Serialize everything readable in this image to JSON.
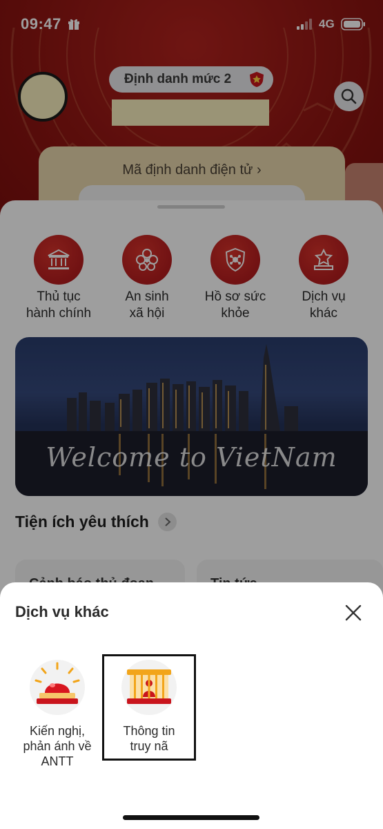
{
  "status_bar": {
    "time": "09:47",
    "network": "4G",
    "icons": [
      "gift-icon",
      "signal-icon",
      "battery-icon"
    ]
  },
  "header": {
    "level_badge": "Định danh mức 2",
    "id_card_title": "Mã định danh điện tử",
    "colors": {
      "header_red": "#8f1512",
      "card_beige": "#e9d7ad"
    }
  },
  "services": [
    {
      "label": "Thủ tục\nhành chính",
      "icon": "government-building-icon"
    },
    {
      "label": "An sinh\nxã hội",
      "icon": "social-welfare-icon"
    },
    {
      "label": "Hồ sơ sức\nkhỏe",
      "icon": "health-shield-icon"
    },
    {
      "label": "Dịch vụ\nkhác",
      "icon": "star-podium-icon"
    }
  ],
  "banner": {
    "text": "Welcome to VietNam"
  },
  "favorites": {
    "title": "Tiện ích yêu thích",
    "cards": [
      "Cảnh báo thủ đoạn",
      "Tin tức"
    ]
  },
  "sheet": {
    "title": "Dịch vụ khác",
    "items": [
      {
        "label": "Kiến nghị,\nphản ánh về\nANTT",
        "icon": "siren-alarm-icon"
      },
      {
        "label": "Thông tin\ntruy nã",
        "icon": "prison-bars-icon",
        "highlighted": true
      }
    ]
  }
}
